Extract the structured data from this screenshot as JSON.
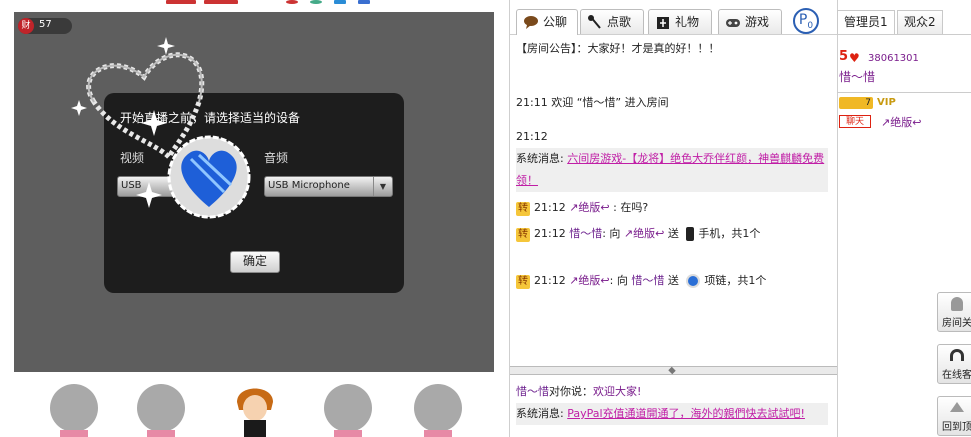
{
  "stage": {
    "wealth_badge": "财",
    "wealth_count": "57",
    "dialog": {
      "title": "开始直播之前，请选择适当的设备",
      "video_label": "视频",
      "audio_label": "音频",
      "video_device": "USB",
      "audio_device": "USB Microphone",
      "confirm_label": "确定"
    }
  },
  "chat": {
    "tabs": [
      {
        "label": "公聊",
        "icon": "chat-bubble-icon"
      },
      {
        "label": "点歌",
        "icon": "music-note-icon"
      },
      {
        "label": "礼物",
        "icon": "gift-icon"
      },
      {
        "label": "游戏",
        "icon": "gamepad-icon"
      }
    ],
    "p_badge": "P",
    "p_count": "0",
    "announcement": "【房间公告】：大家好！才是真的好！！！",
    "welcome_time": "21:11",
    "welcome_text": "欢迎 “惜～惜” 进入房间",
    "time_stamp": "21:12",
    "system1_label": "系统消息:",
    "system1_link": "六间房游戏-【龙将】绝色大乔伴红颜，神兽麒麟免费领！",
    "msg1": {
      "tag": "转",
      "time": "21:12",
      "user": "↗绝版↩",
      "text": ": 在吗?"
    },
    "msg2": {
      "tag": "转",
      "time": "21:12",
      "user": "惜～惜",
      "mid": ": 向",
      "target": "↗绝版↩",
      "send": "送",
      "gift": "手机，共1个"
    },
    "msg3": {
      "tag": "转",
      "time": "21:12",
      "user": "↗绝版↩",
      "mid": ": 向",
      "target": "惜～惜",
      "send": "送",
      "gift": "项链，共1个"
    },
    "private_user": "惜～惜",
    "private_mid": "对你说：",
    "private_text": "欢迎大家!",
    "system2_label": "系统消息:",
    "system2_link": "PayPal充值通道開通了，海外的親們快去試試吧!"
  },
  "users": {
    "tab_admin": "管理员1",
    "tab_viewers": "观众2",
    "host_level": "5",
    "host_id": "38061301",
    "host_name": "惜～惜",
    "user_vip_badge": "VIP",
    "user_chat_badge": "聊天",
    "user_name": "↗绝版↩",
    "btn_room": "房间关",
    "btn_online": "在线客",
    "btn_top": "回到顶"
  },
  "colors": {
    "stage_bg": "#5e5e5e",
    "accent_purple": "#7a1d8c",
    "link_pink": "#c01ea6"
  }
}
